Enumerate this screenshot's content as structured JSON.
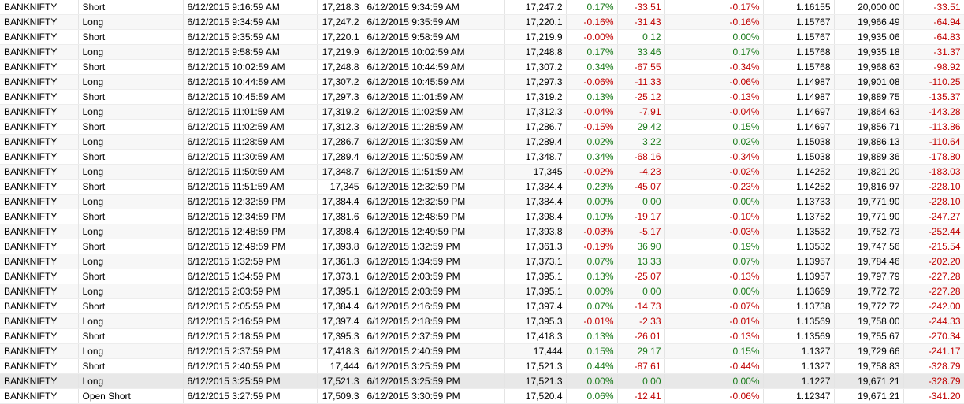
{
  "colors": {
    "positive": "#1a7a1a",
    "negative": "#c00000"
  },
  "trades": [
    [
      "BANKNIFTY",
      "Short",
      "6/12/2015 9:16:59 AM",
      "17,218.3",
      "6/12/2015 9:34:59 AM",
      "17,247.2",
      "0.17%",
      "-33.51",
      "-0.17%",
      "1.16155",
      "20,000.00",
      "-33.51"
    ],
    [
      "BANKNIFTY",
      "Long",
      "6/12/2015 9:34:59 AM",
      "17,247.2",
      "6/12/2015 9:35:59 AM",
      "17,220.1",
      "-0.16%",
      "-31.43",
      "-0.16%",
      "1.15767",
      "19,966.49",
      "-64.94"
    ],
    [
      "BANKNIFTY",
      "Short",
      "6/12/2015 9:35:59 AM",
      "17,220.1",
      "6/12/2015 9:58:59 AM",
      "17,219.9",
      "-0.00%",
      "0.12",
      "0.00%",
      "1.15767",
      "19,935.06",
      "-64.83"
    ],
    [
      "BANKNIFTY",
      "Long",
      "6/12/2015 9:58:59 AM",
      "17,219.9",
      "6/12/2015 10:02:59 AM",
      "17,248.8",
      "0.17%",
      "33.46",
      "0.17%",
      "1.15768",
      "19,935.18",
      "-31.37"
    ],
    [
      "BANKNIFTY",
      "Short",
      "6/12/2015 10:02:59 AM",
      "17,248.8",
      "6/12/2015 10:44:59 AM",
      "17,307.2",
      "0.34%",
      "-67.55",
      "-0.34%",
      "1.15768",
      "19,968.63",
      "-98.92"
    ],
    [
      "BANKNIFTY",
      "Long",
      "6/12/2015 10:44:59 AM",
      "17,307.2",
      "6/12/2015 10:45:59 AM",
      "17,297.3",
      "-0.06%",
      "-11.33",
      "-0.06%",
      "1.14987",
      "19,901.08",
      "-110.25"
    ],
    [
      "BANKNIFTY",
      "Short",
      "6/12/2015 10:45:59 AM",
      "17,297.3",
      "6/12/2015 11:01:59 AM",
      "17,319.2",
      "0.13%",
      "-25.12",
      "-0.13%",
      "1.14987",
      "19,889.75",
      "-135.37"
    ],
    [
      "BANKNIFTY",
      "Long",
      "6/12/2015 11:01:59 AM",
      "17,319.2",
      "6/12/2015 11:02:59 AM",
      "17,312.3",
      "-0.04%",
      "-7.91",
      "-0.04%",
      "1.14697",
      "19,864.63",
      "-143.28"
    ],
    [
      "BANKNIFTY",
      "Short",
      "6/12/2015 11:02:59 AM",
      "17,312.3",
      "6/12/2015 11:28:59 AM",
      "17,286.7",
      "-0.15%",
      "29.42",
      "0.15%",
      "1.14697",
      "19,856.71",
      "-113.86"
    ],
    [
      "BANKNIFTY",
      "Long",
      "6/12/2015 11:28:59 AM",
      "17,286.7",
      "6/12/2015 11:30:59 AM",
      "17,289.4",
      "0.02%",
      "3.22",
      "0.02%",
      "1.15038",
      "19,886.13",
      "-110.64"
    ],
    [
      "BANKNIFTY",
      "Short",
      "6/12/2015 11:30:59 AM",
      "17,289.4",
      "6/12/2015 11:50:59 AM",
      "17,348.7",
      "0.34%",
      "-68.16",
      "-0.34%",
      "1.15038",
      "19,889.36",
      "-178.80"
    ],
    [
      "BANKNIFTY",
      "Long",
      "6/12/2015 11:50:59 AM",
      "17,348.7",
      "6/12/2015 11:51:59 AM",
      "17,345",
      "-0.02%",
      "-4.23",
      "-0.02%",
      "1.14252",
      "19,821.20",
      "-183.03"
    ],
    [
      "BANKNIFTY",
      "Short",
      "6/12/2015 11:51:59 AM",
      "17,345",
      "6/12/2015 12:32:59 PM",
      "17,384.4",
      "0.23%",
      "-45.07",
      "-0.23%",
      "1.14252",
      "19,816.97",
      "-228.10"
    ],
    [
      "BANKNIFTY",
      "Long",
      "6/12/2015 12:32:59 PM",
      "17,384.4",
      "6/12/2015 12:32:59 PM",
      "17,384.4",
      "0.00%",
      "0.00",
      "0.00%",
      "1.13733",
      "19,771.90",
      "-228.10"
    ],
    [
      "BANKNIFTY",
      "Short",
      "6/12/2015 12:34:59 PM",
      "17,381.6",
      "6/12/2015 12:48:59 PM",
      "17,398.4",
      "0.10%",
      "-19.17",
      "-0.10%",
      "1.13752",
      "19,771.90",
      "-247.27"
    ],
    [
      "BANKNIFTY",
      "Long",
      "6/12/2015 12:48:59 PM",
      "17,398.4",
      "6/12/2015 12:49:59 PM",
      "17,393.8",
      "-0.03%",
      "-5.17",
      "-0.03%",
      "1.13532",
      "19,752.73",
      "-252.44"
    ],
    [
      "BANKNIFTY",
      "Short",
      "6/12/2015 12:49:59 PM",
      "17,393.8",
      "6/12/2015 1:32:59 PM",
      "17,361.3",
      "-0.19%",
      "36.90",
      "0.19%",
      "1.13532",
      "19,747.56",
      "-215.54"
    ],
    [
      "BANKNIFTY",
      "Long",
      "6/12/2015 1:32:59 PM",
      "17,361.3",
      "6/12/2015 1:34:59 PM",
      "17,373.1",
      "0.07%",
      "13.33",
      "0.07%",
      "1.13957",
      "19,784.46",
      "-202.20"
    ],
    [
      "BANKNIFTY",
      "Short",
      "6/12/2015 1:34:59 PM",
      "17,373.1",
      "6/12/2015 2:03:59 PM",
      "17,395.1",
      "0.13%",
      "-25.07",
      "-0.13%",
      "1.13957",
      "19,797.79",
      "-227.28"
    ],
    [
      "BANKNIFTY",
      "Long",
      "6/12/2015 2:03:59 PM",
      "17,395.1",
      "6/12/2015 2:03:59 PM",
      "17,395.1",
      "0.00%",
      "0.00",
      "0.00%",
      "1.13669",
      "19,772.72",
      "-227.28"
    ],
    [
      "BANKNIFTY",
      "Short",
      "6/12/2015 2:05:59 PM",
      "17,384.4",
      "6/12/2015 2:16:59 PM",
      "17,397.4",
      "0.07%",
      "-14.73",
      "-0.07%",
      "1.13738",
      "19,772.72",
      "-242.00"
    ],
    [
      "BANKNIFTY",
      "Long",
      "6/12/2015 2:16:59 PM",
      "17,397.4",
      "6/12/2015 2:18:59 PM",
      "17,395.3",
      "-0.01%",
      "-2.33",
      "-0.01%",
      "1.13569",
      "19,758.00",
      "-244.33"
    ],
    [
      "BANKNIFTY",
      "Short",
      "6/12/2015 2:18:59 PM",
      "17,395.3",
      "6/12/2015 2:37:59 PM",
      "17,418.3",
      "0.13%",
      "-26.01",
      "-0.13%",
      "1.13569",
      "19,755.67",
      "-270.34"
    ],
    [
      "BANKNIFTY",
      "Long",
      "6/12/2015 2:37:59 PM",
      "17,418.3",
      "6/12/2015 2:40:59 PM",
      "17,444",
      "0.15%",
      "29.17",
      "0.15%",
      "1.1327",
      "19,729.66",
      "-241.17"
    ],
    [
      "BANKNIFTY",
      "Short",
      "6/12/2015 2:40:59 PM",
      "17,444",
      "6/12/2015 3:25:59 PM",
      "17,521.3",
      "0.44%",
      "-87.61",
      "-0.44%",
      "1.1327",
      "19,758.83",
      "-328.79"
    ],
    [
      "BANKNIFTY",
      "Long",
      "6/12/2015 3:25:59 PM",
      "17,521.3",
      "6/12/2015 3:25:59 PM",
      "17,521.3",
      "0.00%",
      "0.00",
      "0.00%",
      "1.1227",
      "19,671.21",
      "-328.79"
    ],
    [
      "BANKNIFTY",
      "Open Short",
      "6/12/2015 3:27:59 PM",
      "17,509.3",
      "6/12/2015 3:30:59 PM",
      "17,520.4",
      "0.06%",
      "-12.41",
      "-0.06%",
      "1.12347",
      "19,671.21",
      "-341.20"
    ]
  ]
}
